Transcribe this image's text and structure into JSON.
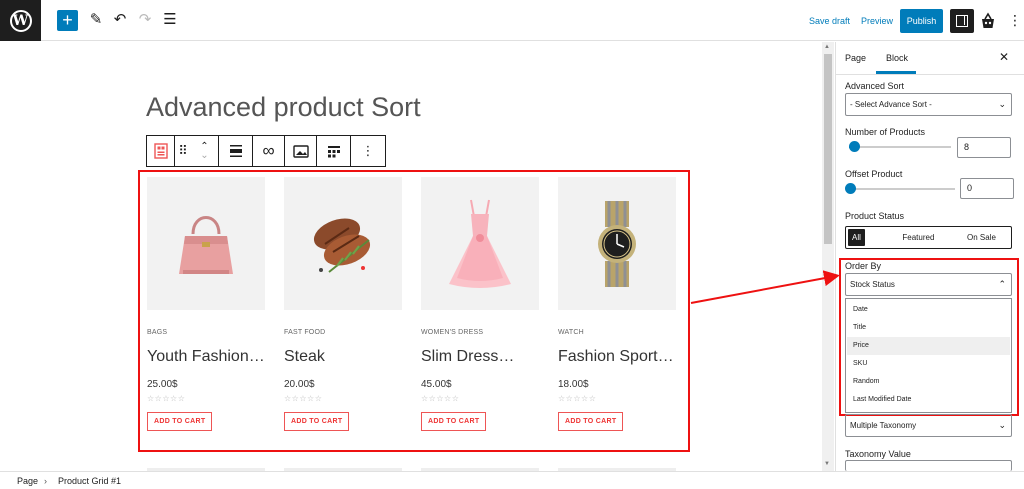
{
  "topbar": {
    "save_draft": "Save draft",
    "preview": "Preview",
    "publish": "Publish",
    "icons": [
      "wordpress-icon",
      "plus-icon",
      "pen-icon",
      "undo-icon",
      "redo-icon",
      "list-view-icon",
      "settings-panel-icon",
      "woocommerce-bag-icon",
      "more-vertical-icon"
    ]
  },
  "canvas": {
    "heading": "Advanced product Sort",
    "products": [
      {
        "category": "BAGS",
        "name": "Youth Fashion…",
        "price": "25.00$",
        "cart": "ADD TO CART",
        "image": "handbag"
      },
      {
        "category": "FAST FOOD",
        "name": "Steak",
        "price": "20.00$",
        "cart": "ADD TO CART",
        "image": "steak"
      },
      {
        "category": "WOMEN'S DRESS",
        "name": "Slim Dress…",
        "price": "45.00$",
        "cart": "ADD TO CART",
        "image": "dress"
      },
      {
        "category": "WATCH",
        "name": "Fashion Sport…",
        "price": "18.00$",
        "cart": "ADD TO CART",
        "image": "watch"
      }
    ],
    "stars": "☆☆☆☆☆"
  },
  "sidebar": {
    "tabs": [
      "Page",
      "Block"
    ],
    "active_tab": "Block",
    "advanced_sort_label": "Advanced Sort",
    "advanced_sort_value": "- Select Advance Sort -",
    "num_products_label": "Number of Products",
    "num_products_value": "8",
    "offset_label": "Offset Product",
    "offset_value": "0",
    "status_label": "Product Status",
    "status_options": [
      "All",
      "Featured",
      "On Sale"
    ],
    "status_selected": "All",
    "order_by_label": "Order By",
    "order_by_value": "Stock Status",
    "order_by_options": [
      "Date",
      "Title",
      "Price",
      "SKU",
      "Random",
      "Last Modified Date"
    ],
    "order_by_highlighted": "Price",
    "taxonomy_value": "Multiple Taxonomy",
    "taxonomy_value_label": "Taxonomy Value"
  },
  "breadcrumbs": [
    "Page",
    "Product Grid #1"
  ],
  "colors": {
    "accent": "#007cba",
    "highlight_frame": "#e11111",
    "dark": "#1e1e1e"
  }
}
